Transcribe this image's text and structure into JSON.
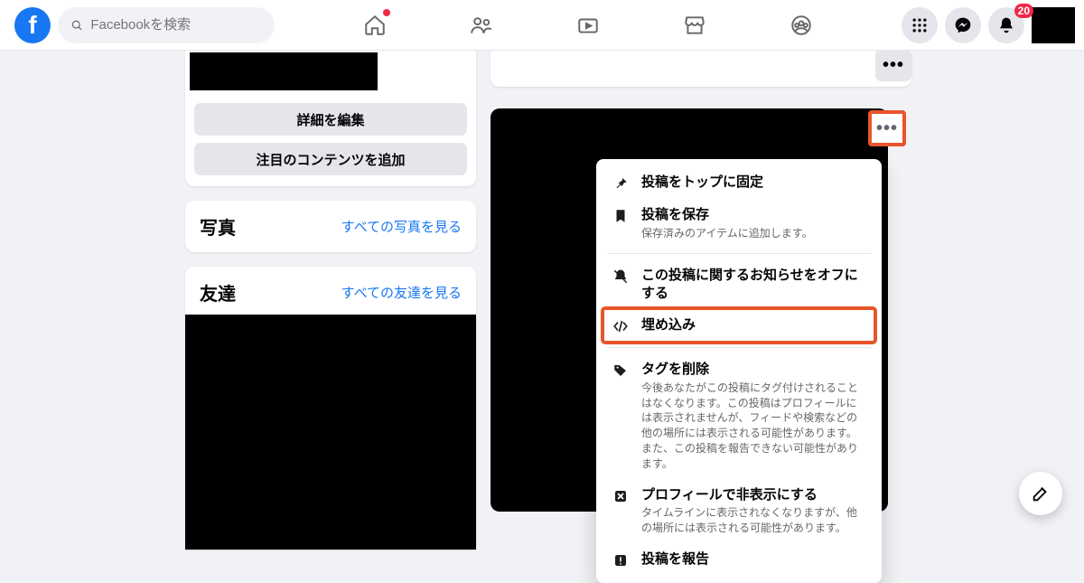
{
  "search": {
    "placeholder": "Facebookを検索"
  },
  "notifications": {
    "badge": "20"
  },
  "left": {
    "edit_details": "詳細を編集",
    "add_featured": "注目のコンテンツを追加",
    "photos_title": "写真",
    "photos_link": "すべての写真を見る",
    "friends_title": "友達",
    "friends_link": "すべての友達を見る"
  },
  "post_menu": {
    "pin": "投稿をトップに固定",
    "save": "投稿を保存",
    "save_sub": "保存済みのアイテムに追加します。",
    "notif_off": "この投稿に関するお知らせをオフにする",
    "embed": "埋め込み",
    "remove_tag": "タグを削除",
    "remove_tag_sub": "今後あなたがこの投稿にタグ付けされることはなくなります。この投稿はプロフィールには表示されませんが、フィードや検索などの他の場所には表示される可能性があります。また、この投稿を報告できない可能性があります。",
    "hide_profile": "プロフィールで非表示にする",
    "hide_profile_sub": "タイムラインに表示されなくなりますが、他の場所には表示される可能性があります。",
    "report": "投稿を報告"
  }
}
